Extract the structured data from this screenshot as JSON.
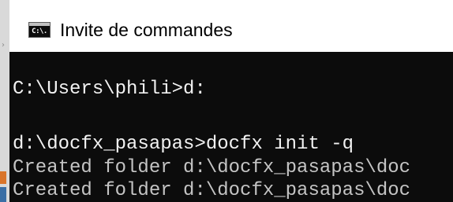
{
  "window": {
    "title": "Invite de commandes",
    "icon": "console-icon",
    "icon_glyph": "C:\\."
  },
  "console": {
    "background": "#0c0c0c",
    "text_color": "#f2f2f2",
    "lines": [
      "C:\\Users\\phili>d:",
      "d:\\docfx_pasapas>docfx init -q",
      "Created folder d:\\docfx_pasapas\\doc",
      "Created folder d:\\docfx_pasapas\\doc"
    ]
  }
}
